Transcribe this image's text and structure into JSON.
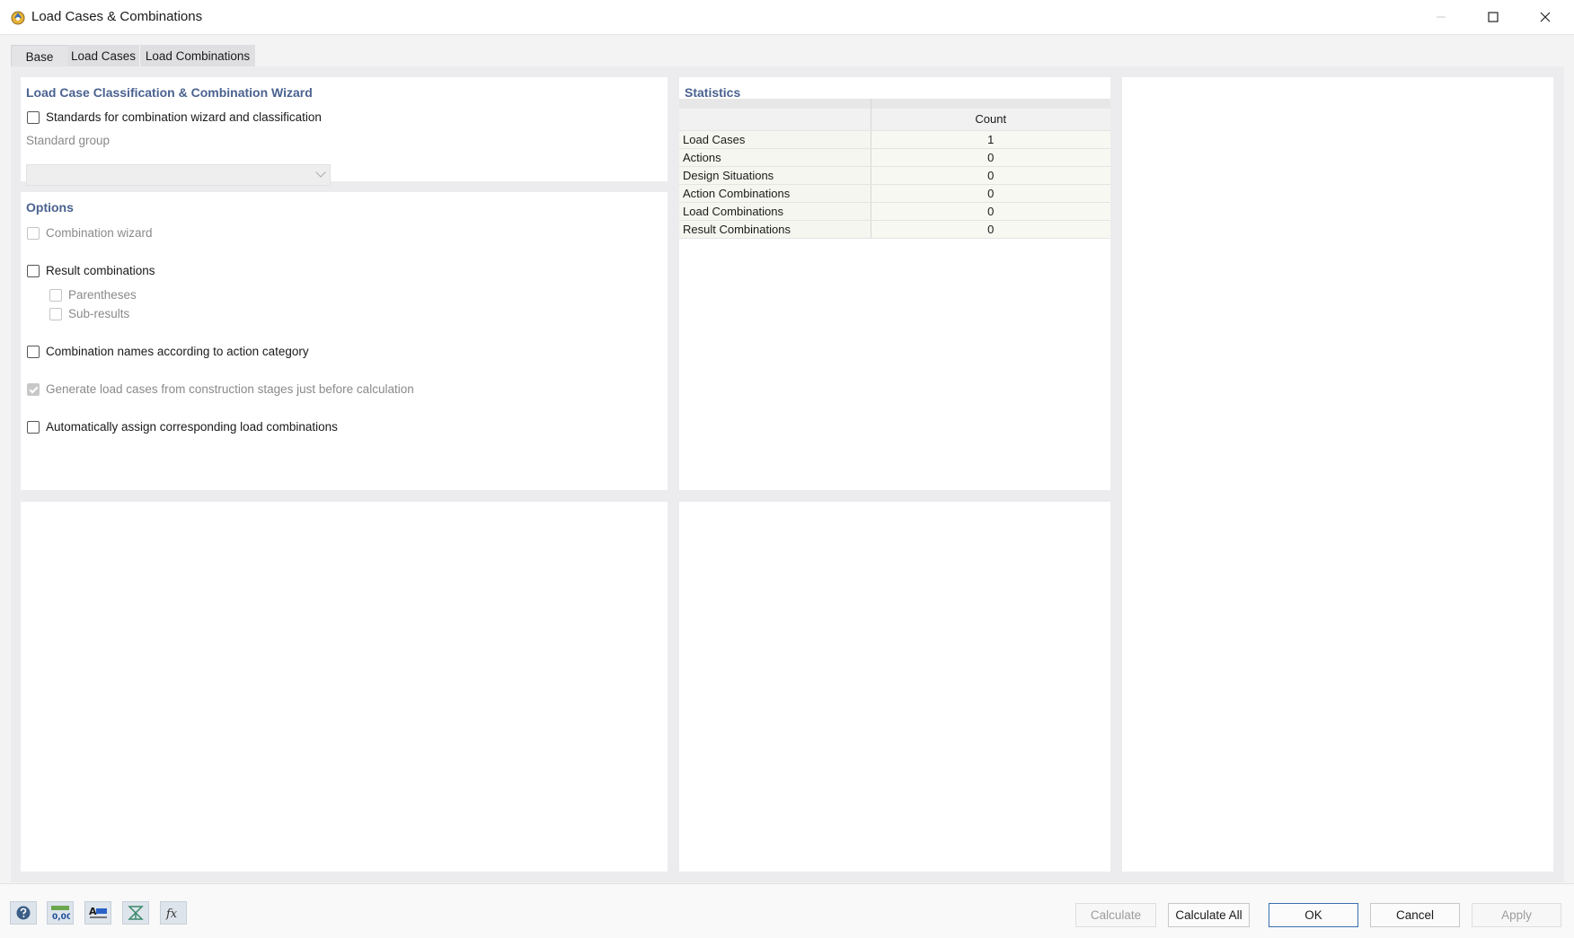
{
  "window": {
    "title": "Load Cases & Combinations"
  },
  "tabs": [
    {
      "label": "Base",
      "active": true
    },
    {
      "label": "Load Cases",
      "active": false
    },
    {
      "label": "Load Combinations",
      "active": false
    }
  ],
  "wizard_panel": {
    "title": "Load Case Classification & Combination Wizard",
    "standards_checkbox": {
      "label": "Standards for combination wizard and classification",
      "checked": false
    },
    "standard_group": {
      "label": "Standard group",
      "value": ""
    }
  },
  "options_panel": {
    "title": "Options",
    "combination_wizard": {
      "label": "Combination wizard",
      "checked": false,
      "enabled": false
    },
    "result_combinations": {
      "label": "Result combinations",
      "checked": false
    },
    "parentheses": {
      "label": "Parentheses",
      "checked": false,
      "enabled": false
    },
    "sub_results": {
      "label": "Sub-results",
      "checked": false,
      "enabled": false
    },
    "combination_names": {
      "label": "Combination names according to action category",
      "checked": false
    },
    "generate_load_cases": {
      "label": "Generate load cases from construction stages just before calculation",
      "checked": true,
      "enabled": false
    },
    "auto_assign": {
      "label": "Automatically assign corresponding load combinations",
      "checked": false
    }
  },
  "statistics": {
    "title": "Statistics",
    "column_header": "Count",
    "rows": [
      {
        "name": "Load Cases",
        "count": "1"
      },
      {
        "name": "Actions",
        "count": "0"
      },
      {
        "name": "Design Situations",
        "count": "0"
      },
      {
        "name": "Action Combinations",
        "count": "0"
      },
      {
        "name": "Load Combinations",
        "count": "0"
      },
      {
        "name": "Result Combinations",
        "count": "0"
      }
    ]
  },
  "toolbar_icons": [
    "help-icon",
    "decimal-places-icon",
    "text-format-icon",
    "units-icon",
    "formula-icon"
  ],
  "buttons": {
    "calculate": "Calculate",
    "calculate_all": "Calculate All",
    "ok": "OK",
    "cancel": "Cancel",
    "apply": "Apply"
  },
  "colors": {
    "panel_title": "#4a6290",
    "accent": "#3a6fb0"
  }
}
